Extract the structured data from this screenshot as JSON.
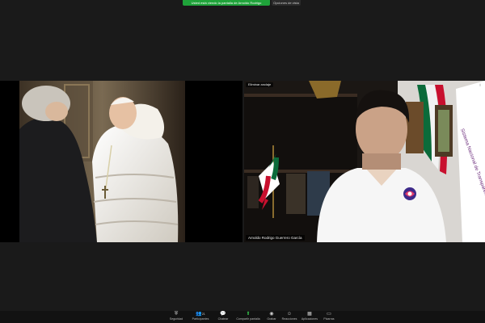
{
  "topbar": {
    "share_banner": "Usted está viendo la pantalla de Arnoldo Rodrigo",
    "view_options": "Opciones de vista"
  },
  "left_tile": {
    "scene": "photo"
  },
  "right_tile": {
    "unpin_label": "Eliminar anclaje",
    "participant_name": "Arnoldo Rodrigo Guerrero García",
    "backdrop_sign": "Sistema Nacional de Transparencia"
  },
  "toolbar": {
    "items": [
      {
        "label": "Seguridad",
        "icon": "shield-icon"
      },
      {
        "label": "Participantes",
        "icon": "participants-icon",
        "count": "21"
      },
      {
        "label": "Chatear",
        "icon": "chat-icon"
      },
      {
        "label": "Compartir pantalla",
        "icon": "share-screen-icon"
      },
      {
        "label": "Grabar",
        "icon": "record-icon"
      },
      {
        "label": "Reacciones",
        "icon": "reactions-icon"
      },
      {
        "label": "Aplicaciones",
        "icon": "apps-icon"
      },
      {
        "label": "Pizarras",
        "icon": "whiteboard-icon"
      }
    ]
  },
  "colors": {
    "share_green": "#1fa33a",
    "background": "#1a1a1a"
  }
}
